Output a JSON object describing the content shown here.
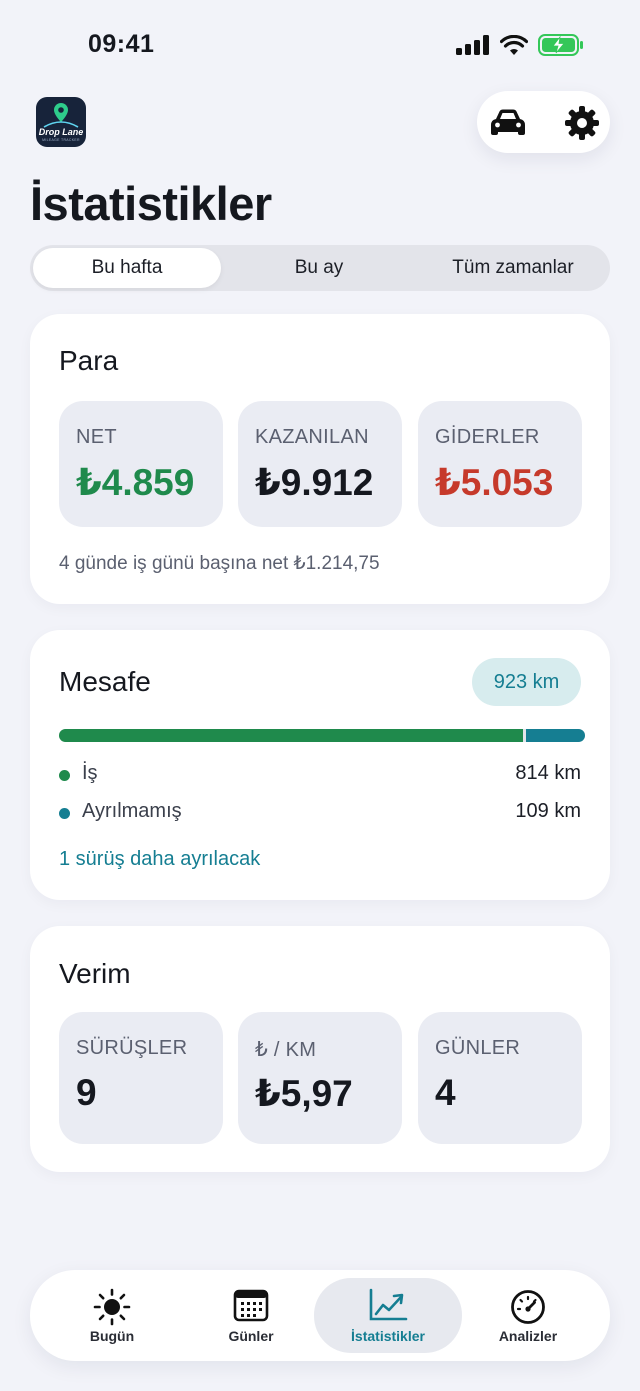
{
  "status": {
    "time": "09:41"
  },
  "app": {
    "logo_text": "Drop Lane",
    "logo_sub": "MILEAGE TRACKER"
  },
  "page": {
    "title": "İstatistikler"
  },
  "segments": [
    {
      "label": "Bu hafta",
      "active": true
    },
    {
      "label": "Bu ay",
      "active": false
    },
    {
      "label": "Tüm zamanlar",
      "active": false
    }
  ],
  "money": {
    "title": "Para",
    "tiles": [
      {
        "label": "NET",
        "value": "₺4.859"
      },
      {
        "label": "KAZANILAN",
        "value": "₺9.912"
      },
      {
        "label": "GİDERLER",
        "value": "₺5.053"
      }
    ],
    "note": "4 günde iş günü başına net ₺1.214,75"
  },
  "distance": {
    "title": "Mesafe",
    "total": "923 km",
    "business_km": 814,
    "unassigned_km": 109,
    "rows": [
      {
        "label": "İş",
        "value": "814 km"
      },
      {
        "label": "Ayrılmamış",
        "value": "109 km"
      }
    ],
    "link": "1 sürüş daha ayrılacak"
  },
  "efficiency": {
    "title": "Verim",
    "tiles": [
      {
        "label": "SÜRÜŞLER",
        "value": "9"
      },
      {
        "label": "₺ / KM",
        "value": "₺5,97"
      },
      {
        "label": "GÜNLER",
        "value": "4"
      }
    ]
  },
  "tabs": [
    {
      "label": "Bugün",
      "icon": "sun-icon"
    },
    {
      "label": "Günler",
      "icon": "calendar-icon"
    },
    {
      "label": "İstatistikler",
      "icon": "chart-icon",
      "active": true
    },
    {
      "label": "Analizler",
      "icon": "gauge-icon"
    }
  ],
  "colors": {
    "green": "#1f8a4c",
    "teal": "#157e92",
    "red": "#c63a2b",
    "battery": "#34c759"
  }
}
